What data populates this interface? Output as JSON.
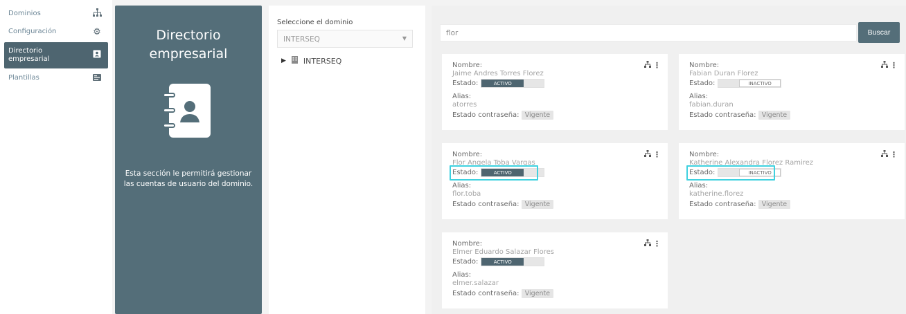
{
  "nav": {
    "items": [
      {
        "label": "Dominios",
        "icon": "sitemap-icon",
        "glyph": "Ⲡ"
      },
      {
        "label": "Configuración",
        "icon": "gear-icon",
        "glyph": "⚙"
      },
      {
        "label": "Directorio empresarial",
        "icon": "address-book-icon",
        "glyph": "▣",
        "active": true
      },
      {
        "label": "Plantillas",
        "icon": "template-icon",
        "glyph": "▤"
      }
    ]
  },
  "info": {
    "title": "Directorio empresarial",
    "description": "Esta sección le permitirá gestionar las cuentas de usuario del dominio."
  },
  "domain": {
    "label": "Seleccione el dominio",
    "selected": "INTERSEQ",
    "tree_root": "INTERSEQ"
  },
  "search": {
    "value": "flor",
    "button_label": "Buscar"
  },
  "labels": {
    "name": "Nombre:",
    "state": "Estado:",
    "alias": "Alias:",
    "password_state": "Estado contraseña:",
    "active": "ACTIVO",
    "inactive": "INACTIVO"
  },
  "cards": [
    {
      "name": "Jaime Andres Torres Florez",
      "active": true,
      "alias": "atorres",
      "password_status": "Vigente"
    },
    {
      "name": "Fabian Duran Florez",
      "active": false,
      "alias": "fabian.duran",
      "password_status": "Vigente"
    },
    {
      "name": "Flor Angela Toba Vargas",
      "active": true,
      "alias": "flor.toba",
      "password_status": "Vigente",
      "highlighted": true
    },
    {
      "name": "Katherine Alexandra Florez Ramirez",
      "active": false,
      "alias": "katherine.florez",
      "password_status": "Vigente",
      "highlighted": true
    },
    {
      "name": "Elmer Eduardo Salazar Flores",
      "active": true,
      "alias": "elmer.salazar",
      "password_status": "Vigente"
    }
  ],
  "colors": {
    "primary": "#546e79",
    "highlight": "#3fd1df"
  }
}
